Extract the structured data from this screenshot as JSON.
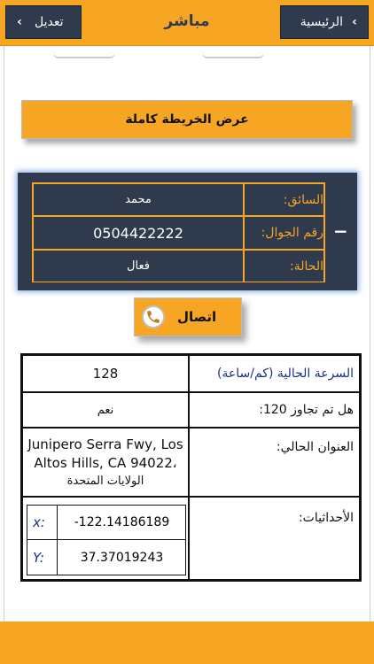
{
  "header": {
    "title": "مباشر",
    "home_label": "الرئيسية",
    "edit_label": "تعديل"
  },
  "map_button": {
    "label": "عرض الخريطة كاملة"
  },
  "driver": {
    "rows": [
      {
        "label": "السائق:",
        "value": "محمد"
      },
      {
        "label": "رقم الجوال:",
        "value": "0504422222"
      },
      {
        "label": "الحالة:",
        "value": "فعال"
      }
    ],
    "collapse_symbol": "−"
  },
  "call_button": {
    "label": "اتصال"
  },
  "info": {
    "speed_label": "السرعة الحالية (كم/ساعة)",
    "speed_value": "128",
    "exceeded_label": "هل تم تجاوز 120:",
    "exceeded_value": "نعم",
    "address_label": "العنوان الحالي:",
    "address_line1": "Junipero Serra Fwy, Los",
    "address_line2": "Altos Hills, CA 94022،",
    "address_line3": "الولايات المتحدة",
    "coords_label": "الأحداثيات:",
    "x_label": "x:",
    "x_value": "-122.14186189",
    "y_label": "Y:",
    "y_value": "37.37019243"
  },
  "icons": {
    "chevron_right": "›",
    "chevron_left": "‹",
    "phone": "phone-icon"
  },
  "colors": {
    "accent": "#f6a623",
    "navy": "#2f3a4d",
    "link_blue": "#1a2f8a"
  }
}
